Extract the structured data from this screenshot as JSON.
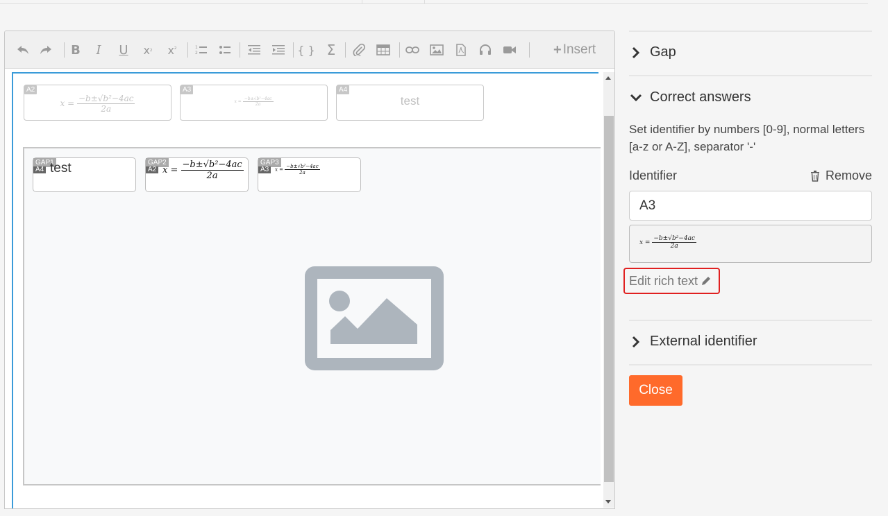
{
  "toolbar": {
    "insert_label": "Insert"
  },
  "answers": [
    {
      "tag": "A2",
      "kind": "formula"
    },
    {
      "tag": "A3",
      "kind": "formula-small"
    },
    {
      "tag": "A4",
      "kind": "text",
      "text": "test"
    }
  ],
  "formula": {
    "lhs": "x =",
    "numerator": "−b±√b²−4ac",
    "denominator": "2a"
  },
  "gaps": [
    {
      "tag": "GAP1",
      "sub": "A4",
      "text": "test"
    },
    {
      "tag": "GAP2",
      "sub": "A2"
    },
    {
      "tag": "GAP3",
      "sub": "A3"
    }
  ],
  "panel": {
    "gap_section": "Gap",
    "correct_section": "Correct answers",
    "description": "Set identifier by numbers [0-9], normal letters [a-z or A-Z], separator '-'",
    "identifier_label": "Identifier",
    "remove_label": "Remove",
    "identifier_value": "A3",
    "edit_rich_label": "Edit rich text",
    "external_section": "External identifier",
    "close_label": "Close"
  },
  "colors": {
    "accent_blue": "#3a9bd9",
    "close_orange": "#ff6a2b",
    "highlight_red": "#e02020"
  }
}
